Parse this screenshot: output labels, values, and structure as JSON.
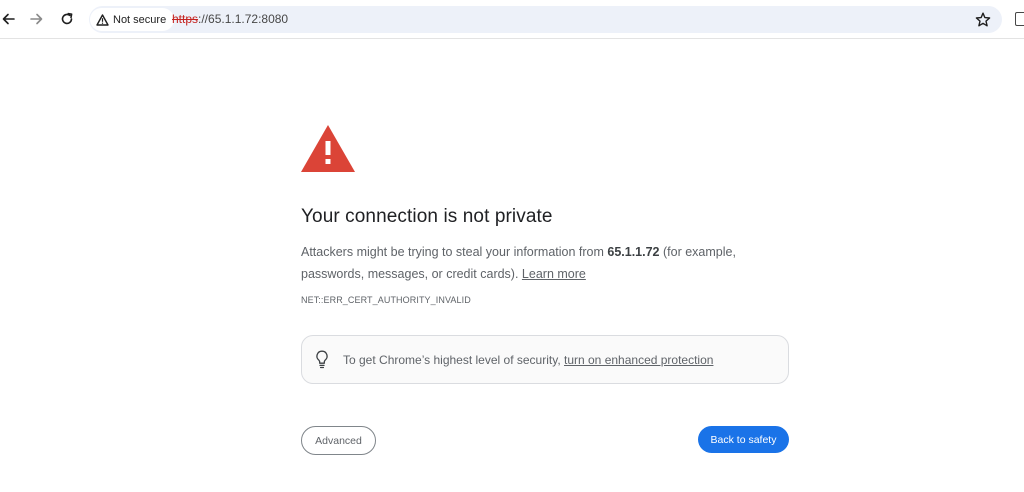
{
  "toolbar": {
    "security_chip": "Not secure",
    "url_scheme": "https",
    "url_rest": "://65.1.1.72:8080",
    "icons": [
      "back-arrow-icon",
      "forward-arrow-icon",
      "reload-icon",
      "warning-triangle-icon",
      "bookmark-star-icon",
      "side-panel-icon"
    ]
  },
  "interstitial": {
    "heading": "Your connection is not private",
    "desc_prefix": "Attackers might be trying to steal your information from ",
    "desc_host": "65.1.1.72",
    "desc_suffix": " (for example, passwords, messages, or credit cards). ",
    "learn_more": "Learn more",
    "error_code": "NET::ERR_CERT_AUTHORITY_INVALID",
    "banner_text": "To get Chrome’s highest level of security, ",
    "banner_link": "turn on enhanced protection",
    "advanced_label": "Advanced",
    "back_label": "Back to safety"
  },
  "colors": {
    "warning_red": "#db4437",
    "primary_blue": "#1a73e8",
    "omnibox_bg": "#edf1f9",
    "insecure_scheme": "#c5221f"
  }
}
